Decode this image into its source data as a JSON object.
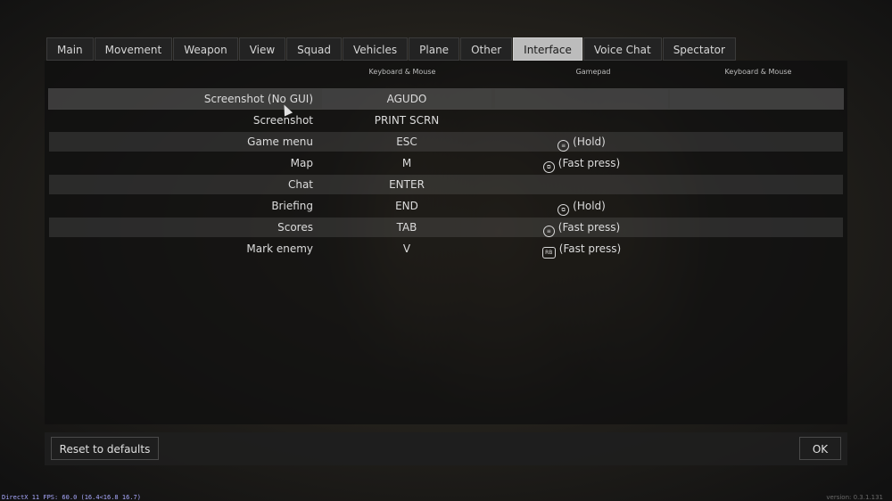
{
  "tabs": [
    {
      "label": "Main",
      "active": false
    },
    {
      "label": "Movement",
      "active": false
    },
    {
      "label": "Weapon",
      "active": false
    },
    {
      "label": "View",
      "active": false
    },
    {
      "label": "Squad",
      "active": false
    },
    {
      "label": "Vehicles",
      "active": false
    },
    {
      "label": "Plane",
      "active": false
    },
    {
      "label": "Other",
      "active": false
    },
    {
      "label": "Interface",
      "active": true
    },
    {
      "label": "Voice Chat",
      "active": false
    },
    {
      "label": "Spectator",
      "active": false
    }
  ],
  "columns": {
    "keyboard_mouse": "Keyboard & Mouse",
    "gamepad": "Gamepad",
    "keyboard_mouse_2": "Keyboard & Mouse"
  },
  "bindings": [
    {
      "action": "Screenshot (No GUI)",
      "key": "AGUDO",
      "gamepad_icon": "",
      "gamepad": "",
      "key2": ""
    },
    {
      "action": "Screenshot",
      "key": "PRINT SCRN",
      "gamepad_icon": "",
      "gamepad": "",
      "key2": ""
    },
    {
      "action": "Game menu",
      "key": "ESC",
      "gamepad_icon": "menu-button-icon",
      "gamepad": "(Hold)",
      "key2": ""
    },
    {
      "action": "Map",
      "key": "M",
      "gamepad_icon": "view-button-icon",
      "gamepad": "(Fast press)",
      "key2": ""
    },
    {
      "action": "Chat",
      "key": "ENTER",
      "gamepad_icon": "",
      "gamepad": "",
      "key2": ""
    },
    {
      "action": "Briefing",
      "key": "END",
      "gamepad_icon": "view-button-icon",
      "gamepad": "(Hold)",
      "key2": ""
    },
    {
      "action": "Scores",
      "key": "TAB",
      "gamepad_icon": "menu-button-icon",
      "gamepad": "(Fast press)",
      "key2": ""
    },
    {
      "action": "Mark enemy",
      "key": "V",
      "gamepad_icon": "rb-button-icon",
      "gamepad": "(Fast press)",
      "key2": ""
    }
  ],
  "footer": {
    "reset_label": "Reset to defaults",
    "ok_label": "OK"
  },
  "status_bar": {
    "fps": "DirectX 11 FPS: 60.0 (16.4<16.8 16.7)",
    "version": "version: 0.3.1.131"
  }
}
